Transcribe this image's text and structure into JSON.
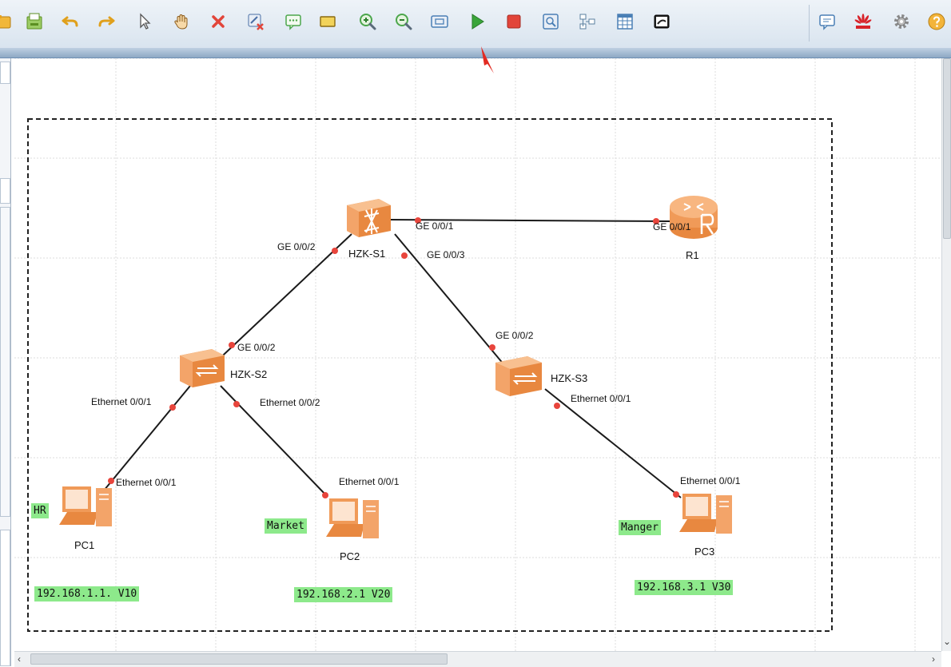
{
  "toolbar": {
    "buttons": [
      {
        "name": "open-folder-icon",
        "color": "#e8a21a"
      },
      {
        "name": "save-icon",
        "color": "#6a9f2a"
      },
      {
        "name": "undo-icon",
        "color": "#e0a01c"
      },
      {
        "name": "redo-icon",
        "color": "#e0a01c"
      },
      {
        "name": "select-pointer-icon",
        "color": "#555555"
      },
      {
        "name": "hand-pan-icon",
        "color": "#d49a3a"
      },
      {
        "name": "delete-icon",
        "color": "#e2453a"
      },
      {
        "name": "delete-connection-icon",
        "color": "#4a6fa5"
      },
      {
        "name": "text-note-icon",
        "color": "#4ca64c"
      },
      {
        "name": "rectangle-icon",
        "color": "#e7c53a"
      },
      {
        "name": "zoom-in-icon",
        "color": "#4ca64c"
      },
      {
        "name": "zoom-out-icon",
        "color": "#4ca64c"
      },
      {
        "name": "fit-view-icon",
        "color": "#4a7fb5"
      },
      {
        "name": "start-device-icon",
        "color": "#3aa53a"
      },
      {
        "name": "stop-device-icon",
        "color": "#e2453a"
      },
      {
        "name": "capture-icon",
        "color": "#4a7fb5"
      },
      {
        "name": "topology-icon",
        "color": "#5a7f9f"
      },
      {
        "name": "table-icon",
        "color": "#4a7fb5"
      },
      {
        "name": "cli-icon",
        "color": "#333333"
      },
      {
        "name": "chat-icon",
        "color": "#4a7fb5"
      },
      {
        "name": "huawei-logo-icon",
        "color": "#d8232a"
      },
      {
        "name": "gear-icon",
        "color": "#888888"
      },
      {
        "name": "help-icon",
        "color": "#e8a21a"
      }
    ]
  },
  "topology": {
    "devices": [
      {
        "id": "s1",
        "label": "HZK-S1",
        "type": "core-switch"
      },
      {
        "id": "r1",
        "label": "R1",
        "type": "router"
      },
      {
        "id": "s2",
        "label": "HZK-S2",
        "type": "switch"
      },
      {
        "id": "s3",
        "label": "HZK-S3",
        "type": "switch"
      },
      {
        "id": "pc1",
        "label": "PC1",
        "type": "pc"
      },
      {
        "id": "pc2",
        "label": "PC2",
        "type": "pc"
      },
      {
        "id": "pc3",
        "label": "PC3",
        "type": "pc"
      }
    ],
    "links": [
      {
        "from": "s1",
        "to": "r1",
        "from_port": "GE 0/0/1",
        "to_port": "GE 0/0/1"
      },
      {
        "from": "s1",
        "to": "s2",
        "from_port": "GE 0/0/2",
        "to_port": "GE 0/0/2"
      },
      {
        "from": "s1",
        "to": "s3",
        "from_port": "GE 0/0/3",
        "to_port": "GE 0/0/2"
      },
      {
        "from": "s2",
        "to": "pc1",
        "from_port": "Ethernet 0/0/1",
        "to_port": "Ethernet 0/0/1"
      },
      {
        "from": "s2",
        "to": "pc2",
        "from_port": "Ethernet 0/0/2",
        "to_port": "Ethernet 0/0/1"
      },
      {
        "from": "s3",
        "to": "pc3",
        "from_port": "Ethernet 0/0/1",
        "to_port": "Ethernet 0/0/1"
      }
    ],
    "notes": {
      "hr": "HR",
      "market": "Market",
      "manger": "Manger",
      "ip1": "192.168.1.1. V10",
      "ip2": "192.168.2.1 V20",
      "ip3": "192.168.3.1 V30"
    },
    "colors": {
      "device": "#f0a060",
      "link": "#1a1a1a",
      "port_dot": "#e8453c",
      "note_bg": "#8de98b",
      "grid": "#dcdcdc"
    }
  }
}
